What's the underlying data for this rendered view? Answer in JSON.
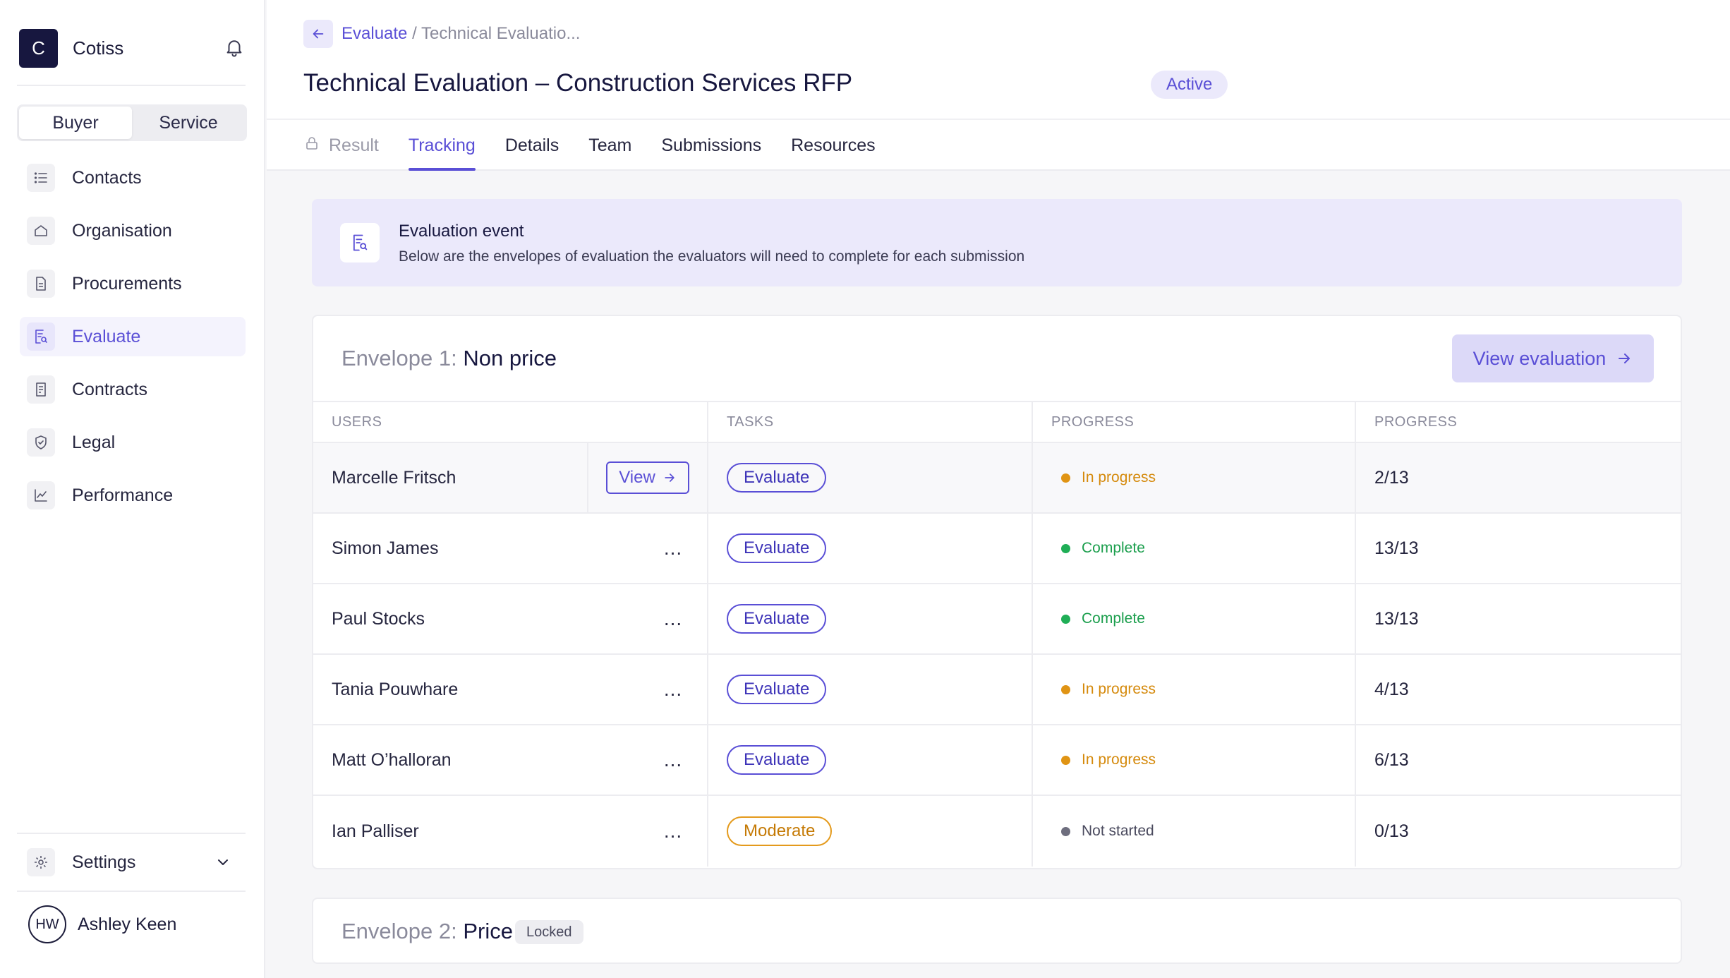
{
  "app": {
    "logo_letter": "C",
    "name": "Cotiss"
  },
  "sidebar": {
    "toggle": {
      "buyer": "Buyer",
      "service": "Service",
      "active": "buyer"
    },
    "items": [
      {
        "label": "Contacts",
        "icon": "list-icon"
      },
      {
        "label": "Organisation",
        "icon": "home-icon"
      },
      {
        "label": "Procurements",
        "icon": "document-icon"
      },
      {
        "label": "Evaluate",
        "icon": "evaluate-icon",
        "active": true
      },
      {
        "label": "Contracts",
        "icon": "contract-icon"
      },
      {
        "label": "Legal",
        "icon": "shield-icon"
      },
      {
        "label": "Performance",
        "icon": "chart-icon"
      }
    ],
    "settings": "Settings",
    "user": {
      "initials": "HW",
      "name": "Ashley Keen"
    }
  },
  "header": {
    "breadcrumb": {
      "link": "Evaluate",
      "separator": "/",
      "current": "Technical Evaluatio..."
    },
    "title": "Technical Evaluation – Construction Services RFP",
    "status": "Active",
    "tabs": [
      {
        "label": "Result",
        "state": "locked"
      },
      {
        "label": "Tracking",
        "state": "active"
      },
      {
        "label": "Details"
      },
      {
        "label": "Team"
      },
      {
        "label": "Submissions"
      },
      {
        "label": "Resources"
      }
    ]
  },
  "banner": {
    "title": "Evaluation event",
    "subtitle": "Below are the envelopes of evaluation the evaluators will need to complete for each submission"
  },
  "envelope1": {
    "prefix": "Envelope 1:",
    "name": "Non price",
    "view_button": "View evaluation",
    "columns": [
      "USERS",
      "TASKS",
      "PROGRESS",
      "PROGRESS"
    ],
    "view_label": "View",
    "more_label": "...",
    "rows": [
      {
        "user": "Marcelle Fritsch",
        "task": "Evaluate",
        "status": "In progress",
        "count": "2/13"
      },
      {
        "user": "Simon James",
        "task": "Evaluate",
        "status": "Complete",
        "count": "13/13"
      },
      {
        "user": "Paul Stocks",
        "task": "Evaluate",
        "status": "Complete",
        "count": "13/13"
      },
      {
        "user": "Tania Pouwhare",
        "task": "Evaluate",
        "status": "In progress",
        "count": "4/13"
      },
      {
        "user": "Matt O’halloran",
        "task": "Evaluate",
        "status": "In progress",
        "count": "6/13"
      },
      {
        "user": "Ian Palliser",
        "task": "Moderate",
        "status": "Not started",
        "count": "0/13"
      }
    ]
  },
  "envelope2": {
    "prefix": "Envelope 2:",
    "name": "Price",
    "badge": "Locked"
  },
  "colors": {
    "accent": "#5a4fd6",
    "in_progress": "#e09414",
    "complete": "#1fae56",
    "not_started": "#6e6e7e",
    "moderate": "#e49a1c"
  }
}
